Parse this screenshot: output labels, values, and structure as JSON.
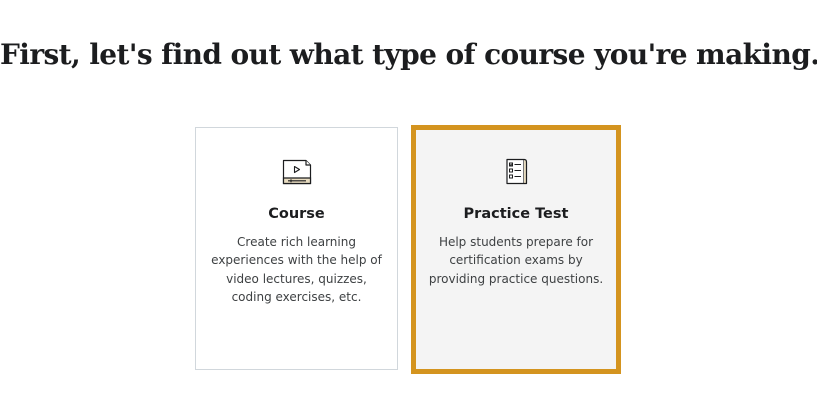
{
  "page": {
    "title": "First, let's find out what type of course you're making."
  },
  "options": [
    {
      "title": "Course",
      "description": "Create rich learning experiences with the help of video lectures, quizzes, coding exercises, etc.",
      "icon": "video-lecture-icon",
      "selected": false
    },
    {
      "title": "Practice Test",
      "description": "Help students prepare for certification exams by providing practice questions.",
      "icon": "checklist-document-icon",
      "selected": true
    }
  ],
  "colors": {
    "selected_border": "#d4941f",
    "selected_background": "#f4f4f4",
    "card_border": "#d1d7dc",
    "text": "#1c1d1f"
  }
}
